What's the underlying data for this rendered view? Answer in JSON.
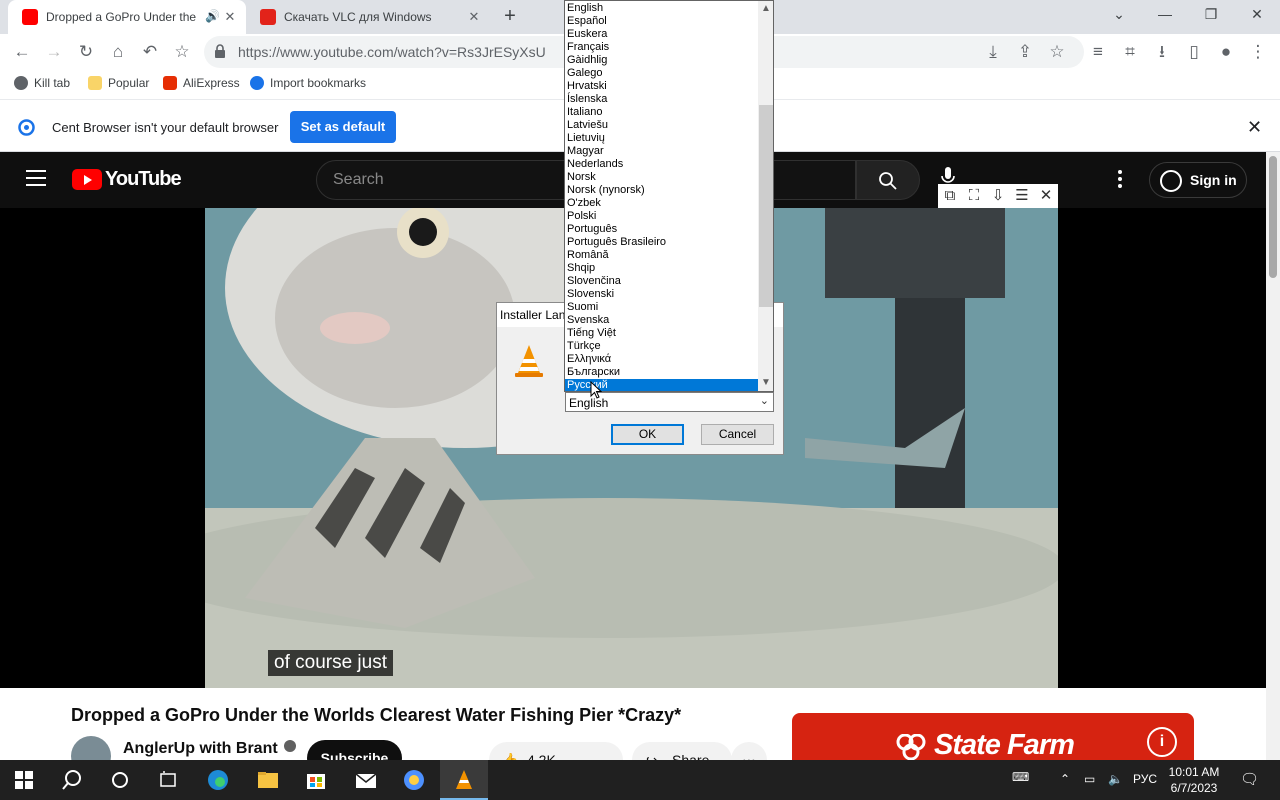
{
  "browser": {
    "tabs": [
      {
        "title": "Dropped a GoPro Under the Wo",
        "active": true
      },
      {
        "title": "Скачать VLC для Windows",
        "active": false
      }
    ],
    "url": "https://www.youtube.com/watch?v=Rs3JrESyXsU",
    "bookmarks": [
      "Kill tab",
      "Popular",
      "AliExpress",
      "Import bookmarks"
    ],
    "infobar": {
      "message": "Cent Browser isn't your default browser",
      "button": "Set as default"
    }
  },
  "youtube": {
    "logo": "YouTube",
    "search_placeholder": "Search",
    "sign_in": "Sign in",
    "caption": "of course just",
    "video_title": "Dropped a GoPro Under the Worlds Clearest Water Fishing Pier *Crazy*",
    "channel": "AnglerUp with Brant",
    "subscribe": "Subscribe",
    "likes": "4.2K",
    "share": "Share",
    "ad_brand": "State Farm"
  },
  "installer": {
    "title": "Installer Lang",
    "selected": "English",
    "ok": "OK",
    "cancel": "Cancel",
    "languages": [
      "English",
      "Español",
      "Euskera",
      "Français",
      "Gàidhlig",
      "Galego",
      "Hrvatski",
      "Íslenska",
      "Italiano",
      "Latviešu",
      "Lietuvių",
      "Magyar",
      "Nederlands",
      "Norsk",
      "Norsk (nynorsk)",
      "O'zbek",
      "Polski",
      "Português",
      "Português Brasileiro",
      "Română",
      "Shqip",
      "Slovenčina",
      "Slovenski",
      "Suomi",
      "Svenska",
      "Tiếng Việt",
      "Türkçe",
      "Ελληνικά",
      "Български",
      "Русский"
    ],
    "highlighted": "Русский"
  },
  "taskbar": {
    "lang": "РУС",
    "time": "10:01 AM",
    "date": "6/7/2023"
  },
  "colors": {
    "youtube_red": "#ff0000",
    "statefarm_red": "#d62311",
    "selection_blue": "#0078d7",
    "cent_blue": "#1a73e8"
  }
}
